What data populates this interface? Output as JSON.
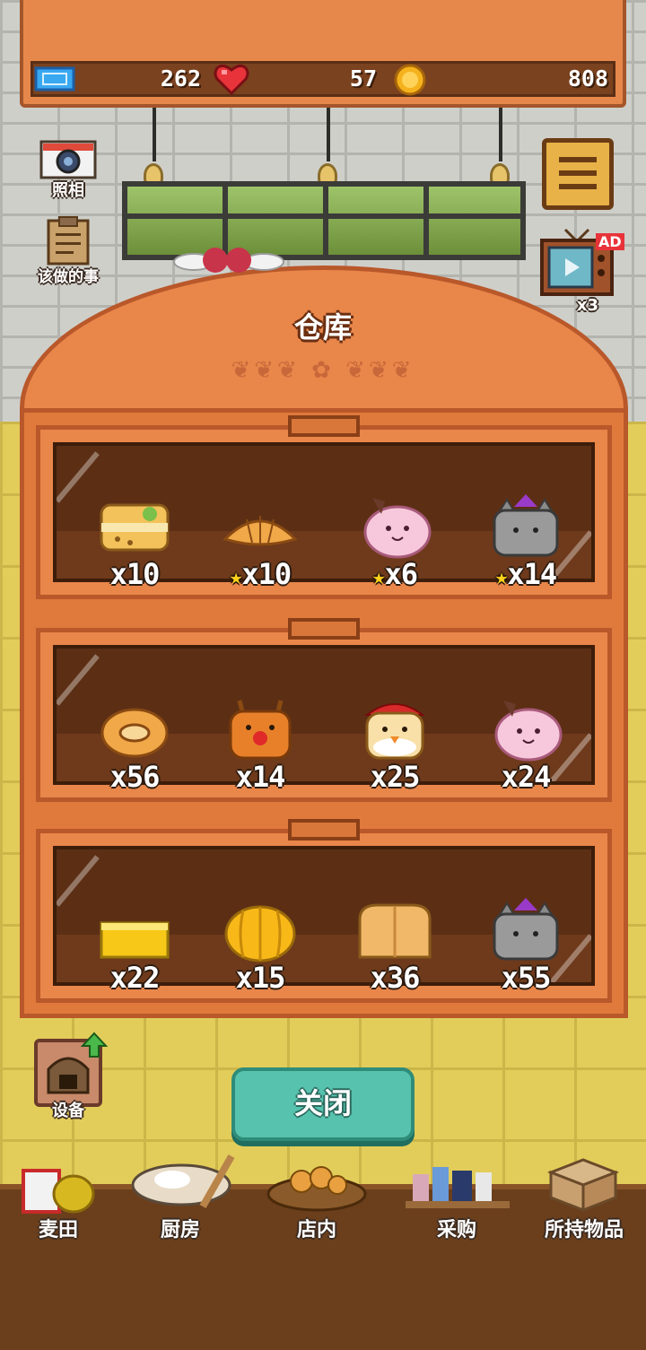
{
  "stats": {
    "tickets": "262",
    "hearts": "57",
    "coins": "808"
  },
  "side": {
    "camera_label": "照相",
    "todo_label": "该做的事",
    "ad_badge": "AD",
    "tv_label": "x3",
    "equipment_label": "设备"
  },
  "warehouse": {
    "title": "仓库",
    "shelves": [
      {
        "items": [
          {
            "icon": "sandwich-icon",
            "star": false,
            "count": "x10"
          },
          {
            "icon": "croissant-icon",
            "star": true,
            "count": "x10"
          },
          {
            "icon": "pink-bun-icon",
            "star": true,
            "count": "x6"
          },
          {
            "icon": "cat-bun-icon",
            "star": true,
            "count": "x14"
          }
        ]
      },
      {
        "items": [
          {
            "icon": "donut-icon",
            "star": false,
            "count": "x56"
          },
          {
            "icon": "reindeer-bread-icon",
            "star": false,
            "count": "x14"
          },
          {
            "icon": "santa-bread-icon",
            "star": false,
            "count": "x25"
          },
          {
            "icon": "pink-bun-icon",
            "star": false,
            "count": "x24"
          }
        ]
      },
      {
        "items": [
          {
            "icon": "sponge-cake-icon",
            "star": false,
            "count": "x22"
          },
          {
            "icon": "pumpkin-bread-icon",
            "star": false,
            "count": "x15"
          },
          {
            "icon": "loaf-icon",
            "star": false,
            "count": "x36"
          },
          {
            "icon": "cat-bun-icon",
            "star": false,
            "count": "x55"
          }
        ]
      }
    ],
    "close_label": "关闭"
  },
  "nav": [
    {
      "label": "麦田",
      "icon": "wheat-field-icon"
    },
    {
      "label": "厨房",
      "icon": "kitchen-icon"
    },
    {
      "label": "店内",
      "icon": "store-icon"
    },
    {
      "label": "采购",
      "icon": "purchase-icon"
    },
    {
      "label": "所持物品",
      "icon": "inventory-box-icon"
    }
  ],
  "colors": {
    "wood": "#e9864a",
    "wood_dark": "#b9582a",
    "teal_button": "#57c2ad",
    "star": "#ffd21a"
  }
}
